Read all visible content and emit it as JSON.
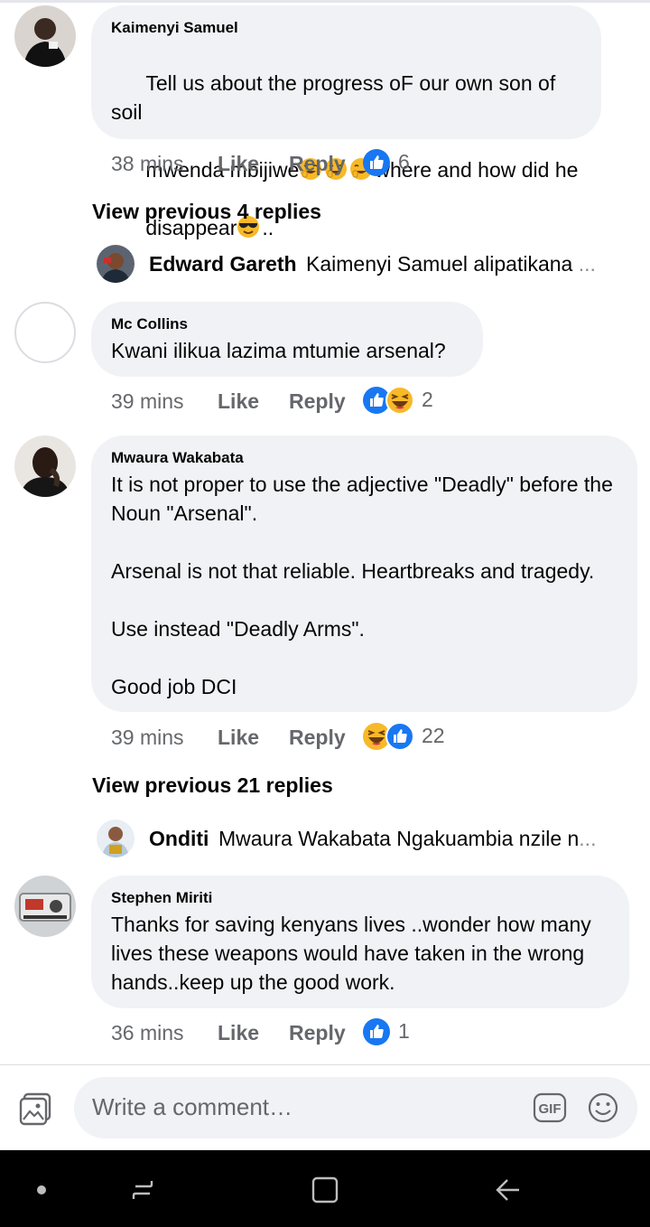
{
  "comments": [
    {
      "author": "Kaimenyi Samuel",
      "text_lines": [
        "Tell us about the progress oF our own son of soil",
        "mwenda mbijiwe",
        "where and how did he",
        "disappear",
        ".."
      ],
      "time": "38 mins",
      "like": "Like",
      "reply": "Reply",
      "reactions": [
        "like"
      ],
      "reaction_count": "6"
    },
    {
      "author": "Mc Collins",
      "text": "Kwani ilikua lazima mtumie arsenal?",
      "time": "39 mins",
      "like": "Like",
      "reply": "Reply",
      "reactions": [
        "like",
        "haha"
      ],
      "reaction_count": "2"
    },
    {
      "author": "Mwaura Wakabata",
      "text": "It is not proper to use the adjective \"Deadly\" before the Noun \"Arsenal\".\n\nArsenal is not that reliable. Heartbreaks and tragedy.\n\nUse instead \"Deadly Arms\".\n\nGood job DCI",
      "time": "39 mins",
      "like": "Like",
      "reply": "Reply",
      "reactions": [
        "haha",
        "like"
      ],
      "reaction_count": "22"
    },
    {
      "author": "Stephen Miriti",
      "text": "Thanks for saving kenyans lives ..wonder how many lives these weapons would have taken in the wrong hands..keep up the good work.",
      "time": "36 mins",
      "like": "Like",
      "reply": "Reply",
      "reactions": [
        "like"
      ],
      "reaction_count": "1"
    }
  ],
  "threads": [
    {
      "view_previous": "View previous 4 replies",
      "reply_author": "Edward Gareth",
      "reply_preview": "Kaimenyi Samuel alipatikana",
      "ellipsis": "..."
    },
    {
      "view_previous": "View previous 21 replies",
      "reply_author": "Onditi",
      "reply_preview": "Mwaura Wakabata Ngakuambia nzile n",
      "ellipsis": "..."
    }
  ],
  "composer": {
    "placeholder": "Write a comment…",
    "gif_label": "GIF"
  },
  "colors": {
    "bubble": "#f0f2f5",
    "like_blue": "#1877f2",
    "haha_yellow": "#f7b928",
    "meta_gray": "#65676b"
  },
  "icons": [
    "photo-icon",
    "gif-icon",
    "emoji-icon",
    "like-reaction-icon",
    "haha-reaction-icon",
    "home-dot-icon",
    "recent-apps-icon",
    "overview-icon",
    "back-icon"
  ]
}
